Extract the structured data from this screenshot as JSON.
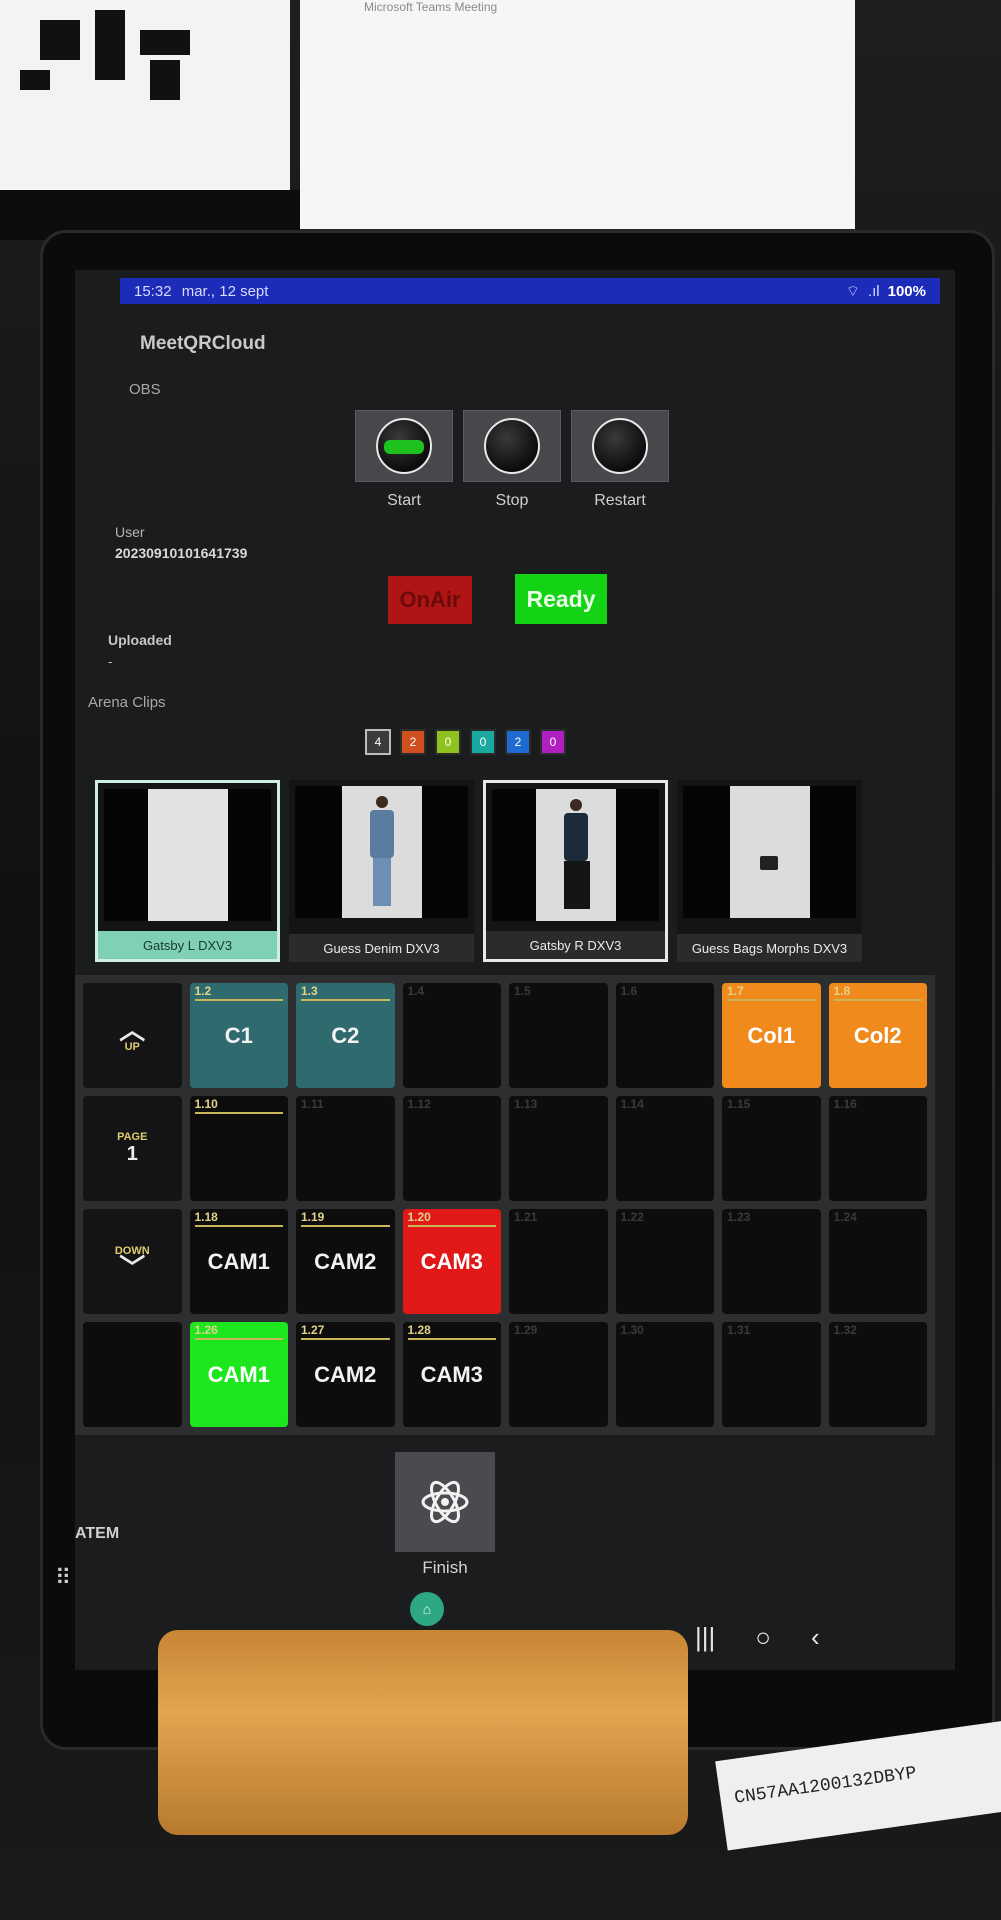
{
  "background": {
    "monitor_text": "Microsoft Teams Meeting"
  },
  "status_bar": {
    "time": "15:32",
    "date": "mar., 12 sept",
    "battery": "100%"
  },
  "app": {
    "title": "MeetQRCloud"
  },
  "obs": {
    "section_label": "OBS",
    "buttons": [
      {
        "label": "Start",
        "icon": "obs-icon",
        "active": true
      },
      {
        "label": "Stop",
        "icon": "obs-icon",
        "active": false
      },
      {
        "label": "Restart",
        "icon": "obs-icon",
        "active": false
      }
    ]
  },
  "user": {
    "label": "User",
    "value": "20230910101641739"
  },
  "status_indicators": {
    "on_air": "OnAir",
    "ready": "Ready",
    "on_air_color": "#b01515",
    "ready_color": "#14d214"
  },
  "uploaded": {
    "label": "Uploaded",
    "value": "-"
  },
  "arena": {
    "label": "Arena Clips",
    "layer_chips": [
      {
        "value": "4",
        "color": "#3a3b3d"
      },
      {
        "value": "2",
        "color": "#d05020"
      },
      {
        "value": "0",
        "color": "#8fc21e"
      },
      {
        "value": "0",
        "color": "#1aa8a0"
      },
      {
        "value": "2",
        "color": "#1f6ad0"
      },
      {
        "value": "0",
        "color": "#b020c0"
      }
    ],
    "clips": [
      {
        "caption": "Gatsby L DXV3",
        "selected": true
      },
      {
        "caption": "Guess Denim DXV3",
        "selected": false
      },
      {
        "caption": "Gatsby R DXV3",
        "selected": false
      },
      {
        "caption": "Guess Bags Morphs DXV3",
        "selected": false
      }
    ]
  },
  "grid": {
    "nav": {
      "up": "UP",
      "page_label": "PAGE",
      "page_number": "1",
      "down": "DOWN"
    },
    "cells": [
      {
        "num": "1.2",
        "label": "C1",
        "style": "teal"
      },
      {
        "num": "1.3",
        "label": "C2",
        "style": "teal"
      },
      {
        "num": "1.4",
        "label": "",
        "style": "empty"
      },
      {
        "num": "1.5",
        "label": "",
        "style": "empty"
      },
      {
        "num": "1.6",
        "label": "",
        "style": "empty"
      },
      {
        "num": "1.7",
        "label": "Col1",
        "style": "orange"
      },
      {
        "num": "1.8",
        "label": "Col2",
        "style": "orange"
      },
      {
        "num": "1.10",
        "label": "",
        "style": "empty-num"
      },
      {
        "num": "1.11",
        "label": "",
        "style": "empty"
      },
      {
        "num": "1.12",
        "label": "",
        "style": "empty"
      },
      {
        "num": "1.13",
        "label": "",
        "style": "empty"
      },
      {
        "num": "1.14",
        "label": "",
        "style": "empty"
      },
      {
        "num": "1.15",
        "label": "",
        "style": "empty"
      },
      {
        "num": "1.16",
        "label": "",
        "style": "empty"
      },
      {
        "num": "1.18",
        "label": "CAM1",
        "style": "dark"
      },
      {
        "num": "1.19",
        "label": "CAM2",
        "style": "dark"
      },
      {
        "num": "1.20",
        "label": "CAM3",
        "style": "red"
      },
      {
        "num": "1.21",
        "label": "",
        "style": "empty"
      },
      {
        "num": "1.22",
        "label": "",
        "style": "empty"
      },
      {
        "num": "1.23",
        "label": "",
        "style": "empty"
      },
      {
        "num": "1.24",
        "label": "",
        "style": "empty"
      },
      {
        "num": "1.26",
        "label": "CAM1",
        "style": "green"
      },
      {
        "num": "1.27",
        "label": "CAM2",
        "style": "dark"
      },
      {
        "num": "1.28",
        "label": "CAM3",
        "style": "dark"
      },
      {
        "num": "1.29",
        "label": "",
        "style": "empty"
      },
      {
        "num": "1.30",
        "label": "",
        "style": "empty"
      },
      {
        "num": "1.31",
        "label": "",
        "style": "empty"
      },
      {
        "num": "1.32",
        "label": "",
        "style": "empty"
      }
    ]
  },
  "finish": {
    "label": "Finish",
    "icon": "atom-icon"
  },
  "atem": {
    "label": "ATEM"
  },
  "device_tag": {
    "text": "CN57AA1200132DBYP"
  }
}
